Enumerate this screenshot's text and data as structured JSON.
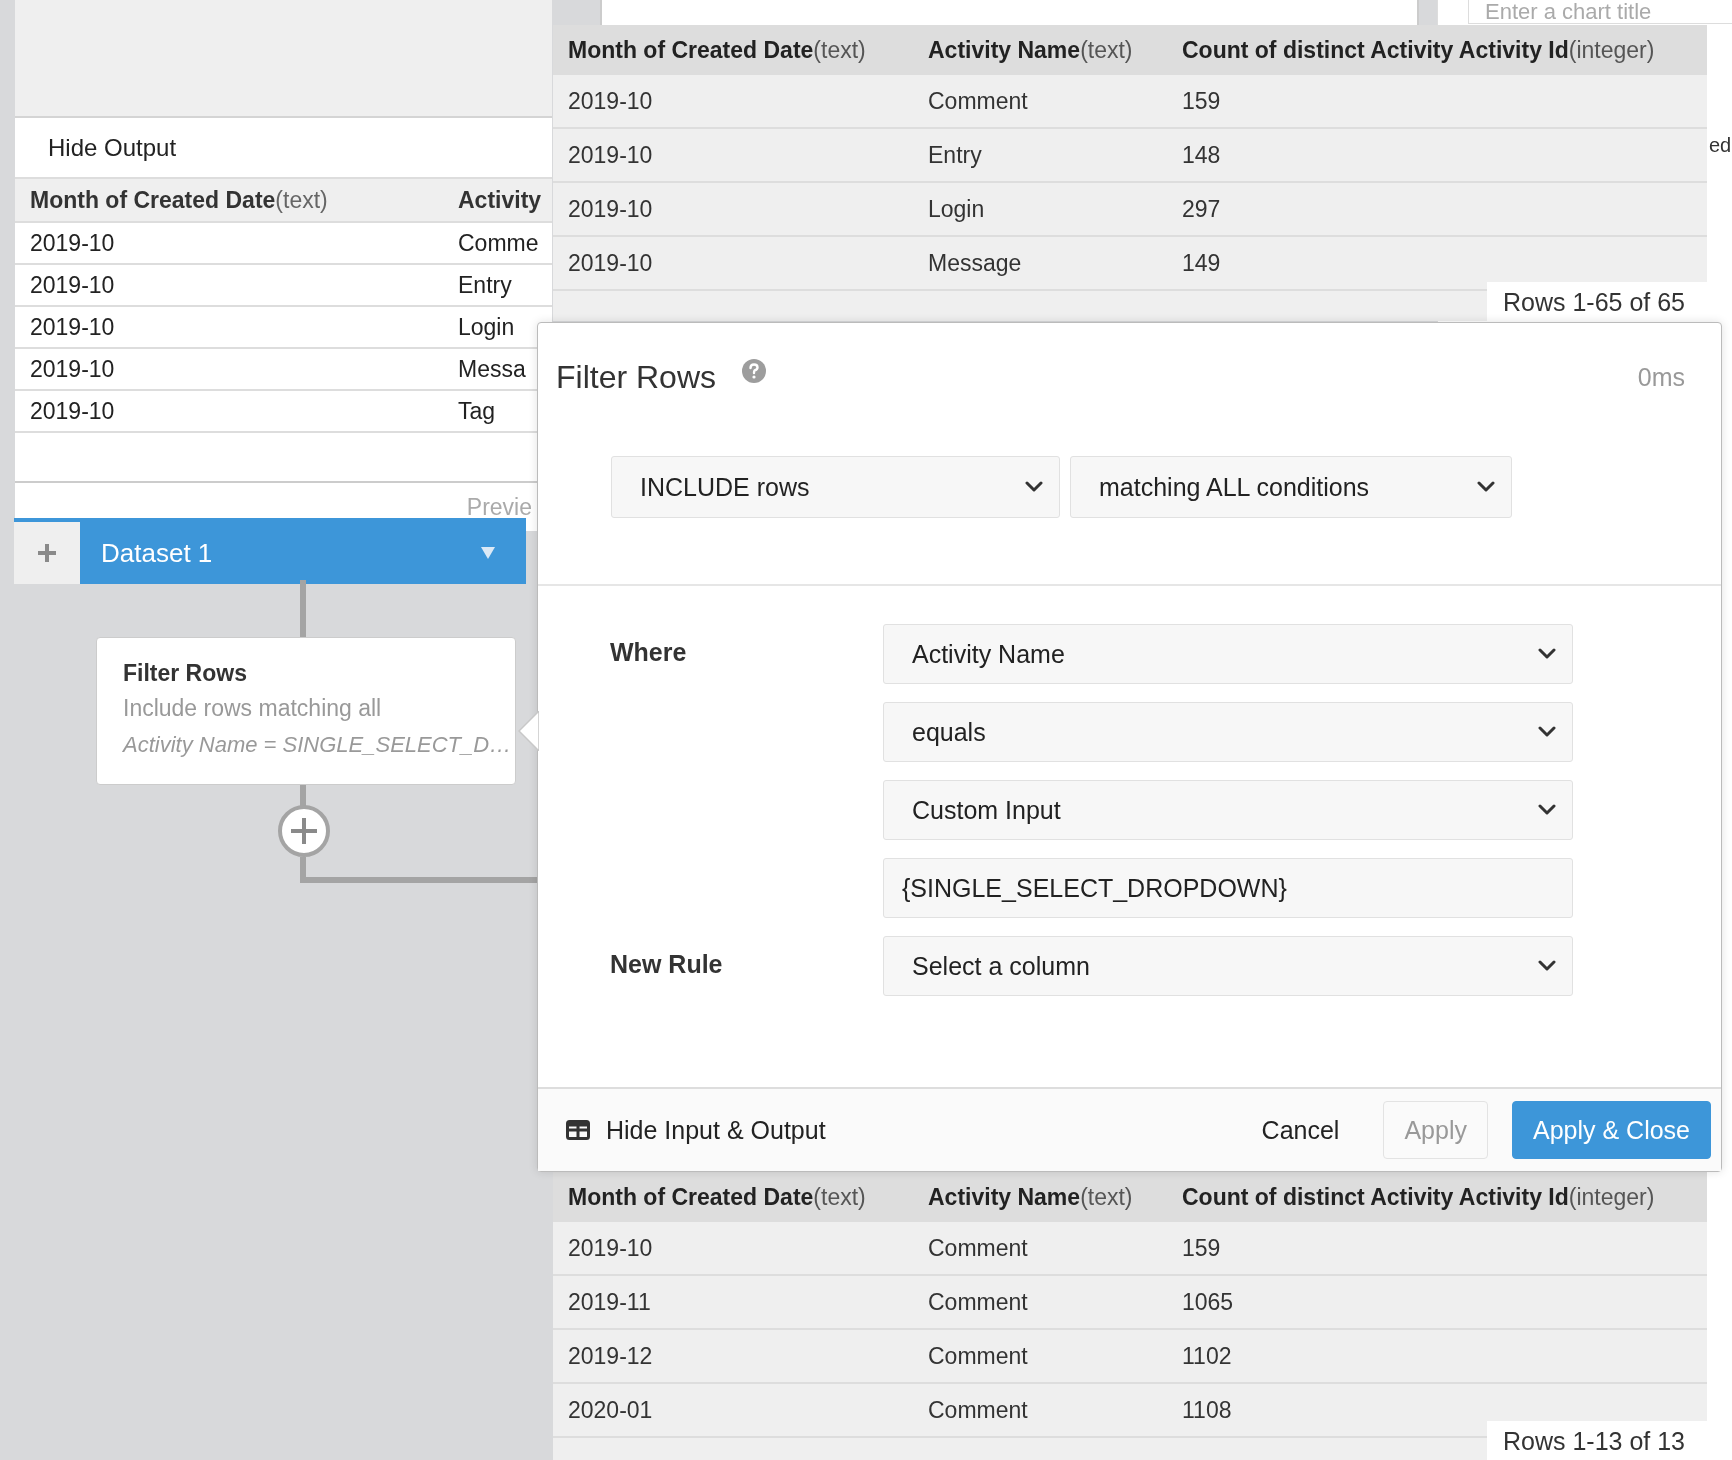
{
  "chart_title_field": {
    "placeholder": "Enter a chart title"
  },
  "side_fragment": "ed",
  "output_panel": {
    "toggle": "Hide Output",
    "columns": [
      {
        "name": "Month of Created Date",
        "type": "(text)"
      },
      {
        "name": "Activity"
      }
    ],
    "rows": [
      [
        "2019-10",
        "Comme"
      ],
      [
        "2019-10",
        "Entry"
      ],
      [
        "2019-10",
        "Login"
      ],
      [
        "2019-10",
        "Messa"
      ],
      [
        "2019-10",
        "Tag"
      ]
    ],
    "footer": "Previe"
  },
  "dataset_tab": {
    "label": "Dataset 1"
  },
  "flow_step": {
    "title": "Filter Rows",
    "summary": "Include rows matching all",
    "condition": "Activity Name = SINGLE_SELECT_D…"
  },
  "input_table": {
    "columns": [
      {
        "name": "Month of Created Date",
        "type": "(text)"
      },
      {
        "name": "Activity Name",
        "type": "(text)"
      },
      {
        "name": "Count of distinct Activity Activity Id",
        "type": "(integer)"
      }
    ],
    "rows": [
      [
        "2019-10",
        "Comment",
        "159"
      ],
      [
        "2019-10",
        "Entry",
        "148"
      ],
      [
        "2019-10",
        "Login",
        "297"
      ],
      [
        "2019-10",
        "Message",
        "149"
      ]
    ],
    "row_count": "Rows 1-65 of 65"
  },
  "filter_dialog": {
    "title": "Filter Rows",
    "timing": "0ms",
    "mode_selects": [
      "INCLUDE rows",
      "matching ALL conditions"
    ],
    "rule": {
      "label": "Where",
      "fields": [
        {
          "kind": "select",
          "value": "Activity Name"
        },
        {
          "kind": "select",
          "value": "equals"
        },
        {
          "kind": "select",
          "value": "Custom Input"
        },
        {
          "kind": "input",
          "value": "{SINGLE_SELECT_DROPDOWN}"
        }
      ]
    },
    "new_rule": {
      "label": "New Rule",
      "value": "Select a column"
    },
    "toggle": "Hide Input & Output",
    "buttons": [
      {
        "label": "Cancel",
        "kind": "link"
      },
      {
        "label": "Apply",
        "kind": "secondary"
      },
      {
        "label": "Apply & Close",
        "kind": "primary"
      }
    ]
  },
  "output_table": {
    "columns": [
      {
        "name": "Month of Created Date",
        "type": "(text)"
      },
      {
        "name": "Activity Name",
        "type": "(text)"
      },
      {
        "name": "Count of distinct Activity Activity Id",
        "type": "(integer)"
      }
    ],
    "rows": [
      [
        "2019-10",
        "Comment",
        "159"
      ],
      [
        "2019-11",
        "Comment",
        "1065"
      ],
      [
        "2019-12",
        "Comment",
        "1102"
      ],
      [
        "2020-01",
        "Comment",
        "1108"
      ]
    ],
    "row_count": "Rows 1-13 of 13"
  }
}
